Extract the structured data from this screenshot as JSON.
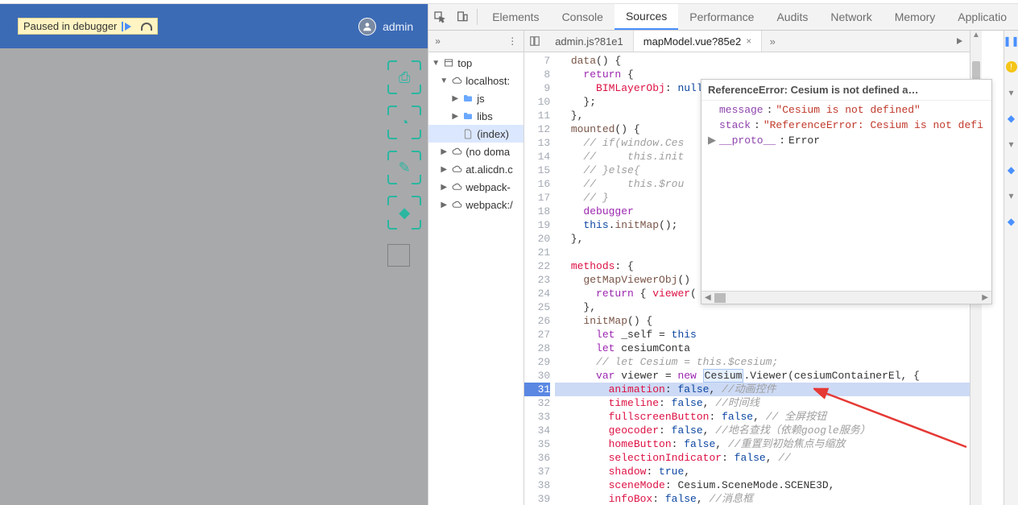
{
  "app_header": {
    "paused_text": "Paused in debugger",
    "username": "admin"
  },
  "devtools": {
    "tabs": [
      "Elements",
      "Console",
      "Sources",
      "Performance",
      "Audits",
      "Network",
      "Memory",
      "Applicatio"
    ],
    "active_tab": 2
  },
  "file_tabs": {
    "items": [
      {
        "label": "admin.js?81e1",
        "active": false
      },
      {
        "label": "mapModel.vue?85e2",
        "active": true
      }
    ]
  },
  "navigator": {
    "tree": [
      {
        "indent": 0,
        "tw": "▼",
        "icon": "window",
        "label": "top"
      },
      {
        "indent": 1,
        "tw": "▼",
        "icon": "cloud",
        "label": "localhost:"
      },
      {
        "indent": 2,
        "tw": "▶",
        "icon": "folder",
        "label": "js"
      },
      {
        "indent": 2,
        "tw": "▶",
        "icon": "folder",
        "label": "libs"
      },
      {
        "indent": 2,
        "tw": "",
        "icon": "file",
        "label": "(index)",
        "sel": true
      },
      {
        "indent": 1,
        "tw": "▶",
        "icon": "cloud",
        "label": "(no doma"
      },
      {
        "indent": 1,
        "tw": "▶",
        "icon": "cloud",
        "label": "at.alicdn.c"
      },
      {
        "indent": 1,
        "tw": "▶",
        "icon": "cloud",
        "label": "webpack-"
      },
      {
        "indent": 1,
        "tw": "▶",
        "icon": "cloud",
        "label": "webpack:/"
      }
    ]
  },
  "editor": {
    "first_line": 7,
    "highlight_line": 31,
    "lines": [
      {
        "n": 7,
        "html": "  <span class='fn'>data</span>() {"
      },
      {
        "n": 8,
        "html": "    <span class='kw'>return</span> {"
      },
      {
        "n": 9,
        "html": "      <span class='prop'>BIMLayerObj</span>: <span class='lit'>null</span>"
      },
      {
        "n": 10,
        "html": "    };"
      },
      {
        "n": 11,
        "html": "  },"
      },
      {
        "n": 12,
        "html": "  <span class='fn'>mounted</span>() {"
      },
      {
        "n": 13,
        "html": "    <span class='cmt'>// if(window.Ces</span>"
      },
      {
        "n": 14,
        "html": "    <span class='cmt'>//     this.init</span>"
      },
      {
        "n": 15,
        "html": "    <span class='cmt'>// }else{</span>"
      },
      {
        "n": 16,
        "html": "    <span class='cmt'>//     this.$rou</span>"
      },
      {
        "n": 17,
        "html": "    <span class='cmt'>// }</span>"
      },
      {
        "n": 18,
        "html": "    <span class='kw'>debugger</span>"
      },
      {
        "n": 19,
        "html": "    <span class='lit'>this</span>.<span class='fn'>initMap</span>();"
      },
      {
        "n": 20,
        "html": "  },"
      },
      {
        "n": 21,
        "html": ""
      },
      {
        "n": 22,
        "html": "  <span class='prop'>methods</span>: {"
      },
      {
        "n": 23,
        "html": "    <span class='fn'>getMapViewerObj</span>()"
      },
      {
        "n": 24,
        "html": "      <span class='kw'>return</span> { <span class='prop'>viewer</span>("
      },
      {
        "n": 25,
        "html": "    },"
      },
      {
        "n": 26,
        "html": "    <span class='fn'>initMap</span>() {"
      },
      {
        "n": 27,
        "html": "      <span class='kw'>let</span> _self = <span class='lit'>this</span>"
      },
      {
        "n": 28,
        "html": "      <span class='kw'>let</span> cesiumConta"
      },
      {
        "n": 29,
        "html": "      <span class='cmt'>// let Cesium = </span><span class='cmt'>this.$cesium;</span>"
      },
      {
        "n": 30,
        "html": "      <span class='kw'>var</span> viewer = <span class='kw'>new</span> <span class='cesium-hl'>Cesium</span>.Viewer(cesiumContainerEl, {"
      },
      {
        "n": 31,
        "html": "        <span class='prop'>animation</span>: <span class='lit'>false</span>, <span class='cmt'>//动画控件</span>"
      },
      {
        "n": 32,
        "html": "        <span class='prop'>timeline</span>: <span class='lit'>false</span>, <span class='cmt'>//时间线</span>"
      },
      {
        "n": 33,
        "html": "        <span class='prop'>fullscreenButton</span>: <span class='lit'>false</span>, <span class='cmt'>// 全屏按钮</span>"
      },
      {
        "n": 34,
        "html": "        <span class='prop'>geocoder</span>: <span class='lit'>false</span>, <span class='cmt'>//地名查找（依赖google服务）</span>"
      },
      {
        "n": 35,
        "html": "        <span class='prop'>homeButton</span>: <span class='lit'>false</span>, <span class='cmt'>//重置到初始焦点与缩放</span>"
      },
      {
        "n": 36,
        "html": "        <span class='prop'>selectionIndicator</span>: <span class='lit'>false</span>, <span class='cmt'>//</span>"
      },
      {
        "n": 37,
        "html": "        <span class='prop'>shadow</span>: <span class='lit'>true</span>,"
      },
      {
        "n": 38,
        "html": "        <span class='prop'>sceneMode</span>: Cesium.SceneMode.SCENE3D,"
      },
      {
        "n": 39,
        "html": "        <span class='prop'>infoBox</span>: <span class='lit'>false</span>, <span class='cmt'>//消息框</span>"
      }
    ]
  },
  "error_popup": {
    "header": "ReferenceError: Cesium is not defined a…",
    "message_key": "message",
    "message_val": "\"Cesium is not defined\"",
    "stack_key": "stack",
    "stack_val": "\"ReferenceError: Cesium is not defi",
    "proto_key": "__proto__",
    "proto_val": "Error"
  },
  "toolbox_icons": [
    "⎙",
    "◔",
    "✎",
    "◆"
  ]
}
